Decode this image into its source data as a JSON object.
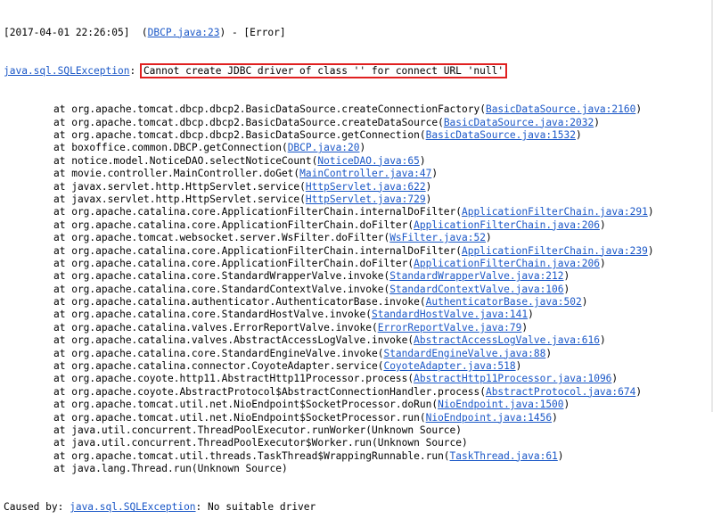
{
  "log": {
    "header": {
      "timestamp_line": "[2017-04-01 22:26:05]  (",
      "source_link": "DBCP.java:23",
      "level_text": ") - [Error]"
    },
    "exception": {
      "class_link": "java.sql.SQLException",
      "separator": ": ",
      "message": "Cannot create JDBC driver of class '' for connect URL 'null'"
    },
    "frames": [
      {
        "text": "at org.apache.tomcat.dbcp.dbcp2.BasicDataSource.createConnectionFactory(",
        "link": "BasicDataSource.java:2160",
        "close": ")"
      },
      {
        "text": "at org.apache.tomcat.dbcp.dbcp2.BasicDataSource.createDataSource(",
        "link": "BasicDataSource.java:2032",
        "close": ")"
      },
      {
        "text": "at org.apache.tomcat.dbcp.dbcp2.BasicDataSource.getConnection(",
        "link": "BasicDataSource.java:1532",
        "close": ")"
      },
      {
        "text": "at boxoffice.common.DBCP.getConnection(",
        "link": "DBCP.java:20",
        "close": ")"
      },
      {
        "text": "at notice.model.NoticeDAO.selectNoticeCount(",
        "link": "NoticeDAO.java:65",
        "close": ")"
      },
      {
        "text": "at movie.controller.MainController.doGet(",
        "link": "MainController.java:47",
        "close": ")"
      },
      {
        "text": "at javax.servlet.http.HttpServlet.service(",
        "link": "HttpServlet.java:622",
        "close": ")"
      },
      {
        "text": "at javax.servlet.http.HttpServlet.service(",
        "link": "HttpServlet.java:729",
        "close": ")"
      },
      {
        "text": "at org.apache.catalina.core.ApplicationFilterChain.internalDoFilter(",
        "link": "ApplicationFilterChain.java:291",
        "close": ")"
      },
      {
        "text": "at org.apache.catalina.core.ApplicationFilterChain.doFilter(",
        "link": "ApplicationFilterChain.java:206",
        "close": ")"
      },
      {
        "text": "at org.apache.tomcat.websocket.server.WsFilter.doFilter(",
        "link": "WsFilter.java:52",
        "close": ")"
      },
      {
        "text": "at org.apache.catalina.core.ApplicationFilterChain.internalDoFilter(",
        "link": "ApplicationFilterChain.java:239",
        "close": ")"
      },
      {
        "text": "at org.apache.catalina.core.ApplicationFilterChain.doFilter(",
        "link": "ApplicationFilterChain.java:206",
        "close": ")"
      },
      {
        "text": "at org.apache.catalina.core.StandardWrapperValve.invoke(",
        "link": "StandardWrapperValve.java:212",
        "close": ")"
      },
      {
        "text": "at org.apache.catalina.core.StandardContextValve.invoke(",
        "link": "StandardContextValve.java:106",
        "close": ")"
      },
      {
        "text": "at org.apache.catalina.authenticator.AuthenticatorBase.invoke(",
        "link": "AuthenticatorBase.java:502",
        "close": ")"
      },
      {
        "text": "at org.apache.catalina.core.StandardHostValve.invoke(",
        "link": "StandardHostValve.java:141",
        "close": ")"
      },
      {
        "text": "at org.apache.catalina.valves.ErrorReportValve.invoke(",
        "link": "ErrorReportValve.java:79",
        "close": ")"
      },
      {
        "text": "at org.apache.catalina.valves.AbstractAccessLogValve.invoke(",
        "link": "AbstractAccessLogValve.java:616",
        "close": ")"
      },
      {
        "text": "at org.apache.catalina.core.StandardEngineValve.invoke(",
        "link": "StandardEngineValve.java:88",
        "close": ")"
      },
      {
        "text": "at org.apache.catalina.connector.CoyoteAdapter.service(",
        "link": "CoyoteAdapter.java:518",
        "close": ")"
      },
      {
        "text": "at org.apache.coyote.http11.AbstractHttp11Processor.process(",
        "link": "AbstractHttp11Processor.java:1096",
        "close": ")"
      },
      {
        "text": "at org.apache.coyote.AbstractProtocol$AbstractConnectionHandler.process(",
        "link": "AbstractProtocol.java:674",
        "close": ")"
      },
      {
        "text": "at org.apache.tomcat.util.net.NioEndpoint$SocketProcessor.doRun(",
        "link": "NioEndpoint.java:1500",
        "close": ")"
      },
      {
        "text": "at org.apache.tomcat.util.net.NioEndpoint$SocketProcessor.run(",
        "link": "NioEndpoint.java:1456",
        "close": ")"
      },
      {
        "text": "at java.util.concurrent.ThreadPoolExecutor.runWorker(Unknown Source)",
        "link": "",
        "close": ""
      },
      {
        "text": "at java.util.concurrent.ThreadPoolExecutor$Worker.run(Unknown Source)",
        "link": "",
        "close": ""
      },
      {
        "text": "at org.apache.tomcat.util.threads.TaskThread$WrappingRunnable.run(",
        "link": "TaskThread.java:61",
        "close": ")"
      },
      {
        "text": "at java.lang.Thread.run(Unknown Source)",
        "link": "",
        "close": ""
      }
    ],
    "caused_by": {
      "prefix": "Caused by: ",
      "class_link": "java.sql.SQLException",
      "message": ": No suitable driver"
    }
  },
  "colors": {
    "link": "#1a57c7",
    "highlight_box": "#e02020",
    "text": "#000000",
    "background": "#ffffff"
  }
}
